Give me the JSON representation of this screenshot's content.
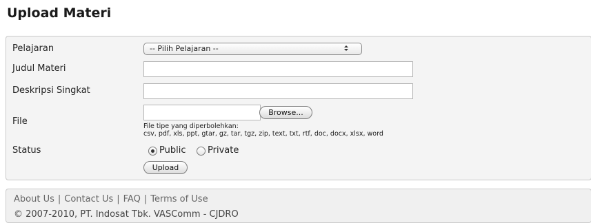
{
  "page": {
    "title": "Upload Materi"
  },
  "form": {
    "pelajaran": {
      "label": "Pelajaran",
      "selected": "-- Pilih Pelajaran --"
    },
    "judul": {
      "label": "Judul Materi",
      "value": ""
    },
    "deskripsi": {
      "label": "Deskripsi Singkat",
      "value": ""
    },
    "file": {
      "label": "File",
      "browse_label": "Browse...",
      "hint_line1": "File tipe yang diperbolehkan:",
      "hint_line2": "csv, pdf, xls, ppt, gtar, gz, tar, tgz, zip, text, txt, rtf, doc, docx, xlsx, word"
    },
    "status": {
      "label": "Status",
      "options": [
        {
          "label": "Public",
          "selected": true
        },
        {
          "label": "Private",
          "selected": false
        }
      ]
    },
    "upload_label": "Upload"
  },
  "footer": {
    "links": [
      "About Us",
      "Contact Us",
      "FAQ",
      "Terms of Use"
    ],
    "separator": "|",
    "copyright": "© 2007-2010, PT. Indosat Tbk. VASComm - CJDRO"
  },
  "icons": {
    "select_arrows": "updown-chevron-icon",
    "radio_selected": "radio-selected-icon",
    "radio_unselected": "radio-unselected-icon"
  }
}
